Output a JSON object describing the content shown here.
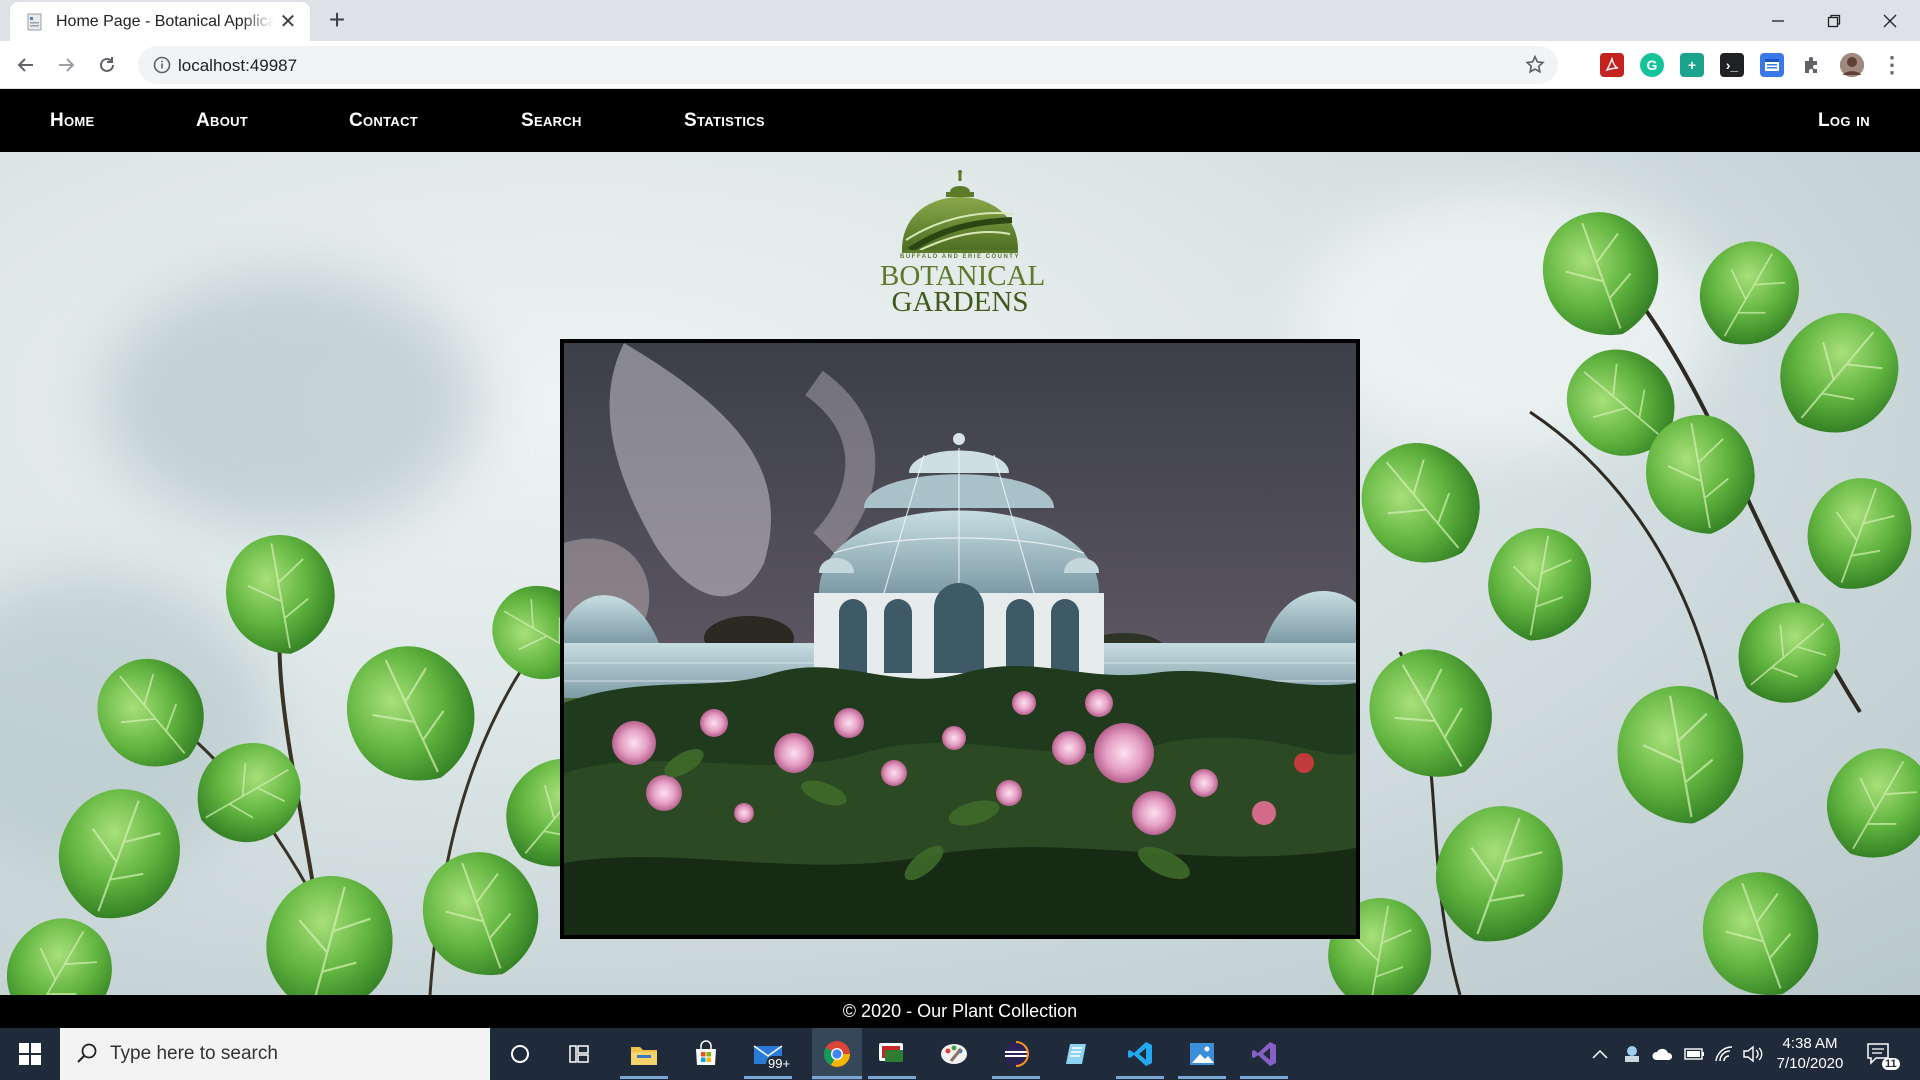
{
  "browser": {
    "tab_title": "Home Page - Botanical Application",
    "url": "localhost:49987"
  },
  "nav": {
    "home": "Home",
    "about": "About",
    "contact": "Contact",
    "search": "Search",
    "statistics": "Statistics",
    "login": "Log in"
  },
  "logo": {
    "small_text": "BUFFALO AND ERIE COUNTY",
    "line1": "BOTANICAL",
    "line2": "GARDENS"
  },
  "footer": {
    "text": "© 2020 - Our Plant Collection"
  },
  "taskbar": {
    "search_placeholder": "Type here to search",
    "mail_badge": "99+",
    "time": "4:38 AM",
    "date": "7/10/2020",
    "notification_count": "11"
  },
  "colors": {
    "nav_bg": "#000000",
    "logo_green": "#5b7a2a",
    "taskbar_bg": "#1f2a3a"
  }
}
